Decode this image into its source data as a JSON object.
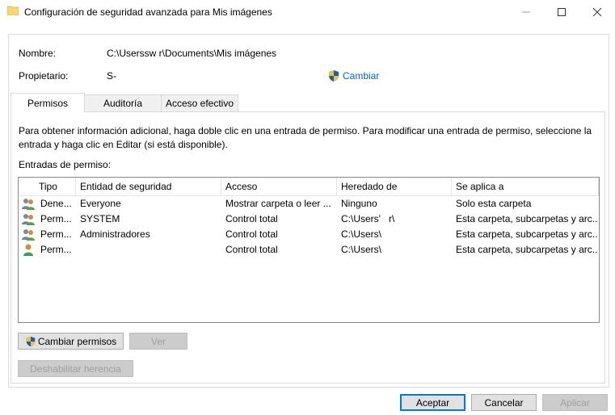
{
  "window": {
    "title": "Configuración de seguridad avanzada para Mis imágenes",
    "minimize_icon": "minimize-icon",
    "maximize_icon": "maximize-icon",
    "close_icon": "close-icon"
  },
  "owner_section": {
    "name_label": "Nombre:",
    "name_value": "C:\\Userssw r\\Documents\\Mis imágenes",
    "owner_label": "Propietario:",
    "owner_value": "S-",
    "change_link": "Cambiar"
  },
  "tabs": [
    {
      "label": "Permisos",
      "active": true
    },
    {
      "label": "Auditoría",
      "active": false
    },
    {
      "label": "Acceso efectivo",
      "active": false
    }
  ],
  "permissions": {
    "info_text": "Para obtener información adicional, haga doble clic en una entrada de permiso. Para modificar una entrada de permiso, seleccione la entrada y haga clic en Editar (si está disponible).",
    "entries_label": "Entradas de permiso:",
    "columns": [
      "Tipo",
      "Entidad de seguridad",
      "Acceso",
      "Heredado de",
      "Se aplica a"
    ],
    "rows": [
      {
        "icon": "group-users-icon",
        "type": "Dene...",
        "principal": "Everyone",
        "access": "Mostrar carpeta o leer ...",
        "inherited": "Ninguno",
        "applies": "Solo esta carpeta"
      },
      {
        "icon": "group-users-icon",
        "type": "Perm...",
        "principal": "SYSTEM",
        "access": "Control total",
        "inherited": "C:\\Users'   r\\",
        "applies": "Esta carpeta, subcarpetas y arc..."
      },
      {
        "icon": "group-users-icon",
        "type": "Perm...",
        "principal": "Administradores",
        "access": "Control total",
        "inherited": "C:\\Users\\",
        "applies": "Esta carpeta, subcarpetas y arc..."
      },
      {
        "icon": "single-user-icon",
        "type": "Perm...",
        "principal": "",
        "access": "Control total",
        "inherited": "C:\\Users\\",
        "applies": "Esta carpeta, subcarpetas y arc..."
      }
    ]
  },
  "buttons": {
    "change_permissions": "Cambiar permisos",
    "view": "Ver",
    "disable_inheritance": "Deshabilitar herencia",
    "accept": "Aceptar",
    "cancel": "Cancelar",
    "apply": "Aplicar"
  },
  "colors": {
    "link": "#0066cc",
    "default_button_border": "#0078d7",
    "folder_icon": "#f8d775"
  }
}
